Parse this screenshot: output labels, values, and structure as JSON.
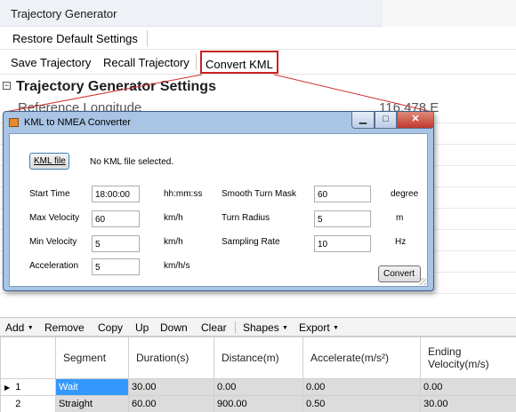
{
  "app": {
    "title": "Trajectory Generator"
  },
  "toolbar1": {
    "restore_label": "Restore Default Settings"
  },
  "toolbar2": {
    "save_label": "Save Trajectory",
    "recall_label": "Recall Trajectory",
    "convert_label": "Convert KML"
  },
  "settings": {
    "title": "Trajectory Generator Settings",
    "ref_label": "Reference Longitude",
    "ref_value": "116.478 E"
  },
  "dialog": {
    "title": "KML to NMEA Converter",
    "kml_button": "KML file",
    "kml_status": "No KML file selected.",
    "start_time": {
      "label": "Start Time",
      "value": "18:00:00",
      "unit": "hh:mm:ss"
    },
    "max_velocity": {
      "label": "Max Velocity",
      "value": "60",
      "unit": "km/h"
    },
    "min_velocity": {
      "label": "Min Velocity",
      "value": "5",
      "unit": "km/h"
    },
    "acceleration": {
      "label": "Acceleration",
      "value": "5",
      "unit": "km/h/s"
    },
    "smooth_turn": {
      "label": "Smooth Turn Mask",
      "value": "60",
      "unit": "degree"
    },
    "turn_radius": {
      "label": "Turn Radius",
      "value": "5",
      "unit": "m"
    },
    "sampling_rate": {
      "label": "Sampling Rate",
      "value": "10",
      "unit": "Hz"
    },
    "convert_button": "Convert"
  },
  "table_toolbar": {
    "add": "Add",
    "remove": "Remove",
    "copy": "Copy",
    "up": "Up",
    "down": "Down",
    "clear": "Clear",
    "shapes": "Shapes",
    "export": "Export"
  },
  "table": {
    "headers": [
      "Segment",
      "Duration(s)",
      "Distance(m)",
      "Accelerate(m/s²)",
      "Ending Velocity(m/s)"
    ],
    "rows": [
      {
        "index": "1",
        "segment": "Wait",
        "duration": "30.00",
        "distance": "0.00",
        "accelerate": "0.00",
        "velocity": "0.00"
      },
      {
        "index": "2",
        "segment": "Straight",
        "duration": "60.00",
        "distance": "900.00",
        "accelerate": "0.50",
        "velocity": "30.00"
      }
    ]
  }
}
